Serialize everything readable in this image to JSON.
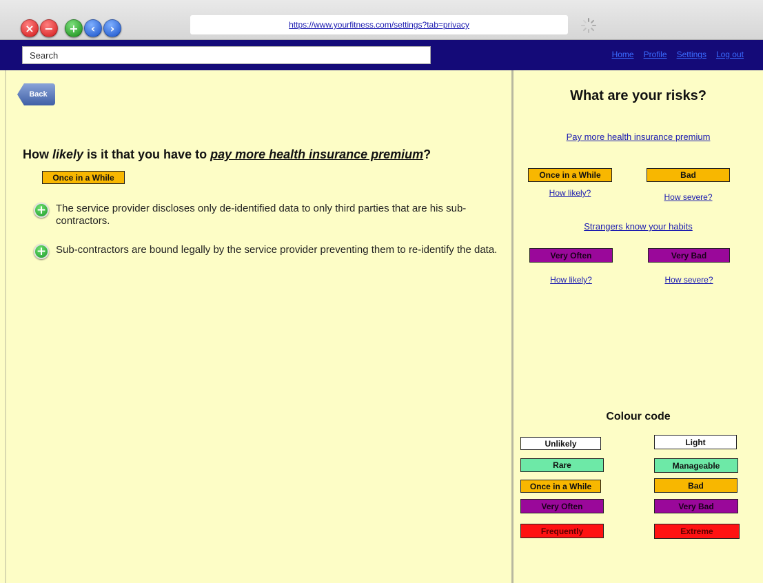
{
  "browser": {
    "url": "https://www.yourfitness.com/settings?tab=privacy",
    "buttons": [
      "×",
      "−",
      "+",
      "‹",
      "›"
    ]
  },
  "nav": {
    "search_placeholder": "Search",
    "links": [
      "Home",
      "Profile",
      "Settings",
      "Log out"
    ]
  },
  "back_label": "Back",
  "question": {
    "prefix": "How ",
    "likely": "likely",
    "middle": " is it that you have to ",
    "risk": "pay more health insurance premium",
    "suffix": "?",
    "answer": "Once in a While"
  },
  "facts": [
    "The service provider discloses only de-identified data to only third parties that are his sub-contractors.",
    "Sub-contractors are bound legally by the service provider preventing them to re-identify the data."
  ],
  "risks_panel": {
    "title": "What are your risks?",
    "risks": [
      {
        "name": "Pay more health insurance premium",
        "likelihood": "Once in a While",
        "severity": "Bad",
        "likely_link": "How likely?",
        "severe_link": "How severe?"
      },
      {
        "name": "Strangers know your habits",
        "likelihood": "Very Often",
        "severity": "Very Bad",
        "likely_link": "How likely?",
        "severe_link": "How severe?"
      }
    ]
  },
  "colour_code": {
    "title": "Colour code",
    "likelihood": [
      "Unlikely",
      "Rare",
      "Once in a While",
      "Very Often",
      "Frequently"
    ],
    "severity": [
      "Light",
      "Manageable",
      "Bad",
      "Very Bad",
      "Extreme"
    ],
    "colors": [
      "#ffffff",
      "#6de9a7",
      "#f8b700",
      "#9a089a",
      "#ff1212"
    ]
  }
}
